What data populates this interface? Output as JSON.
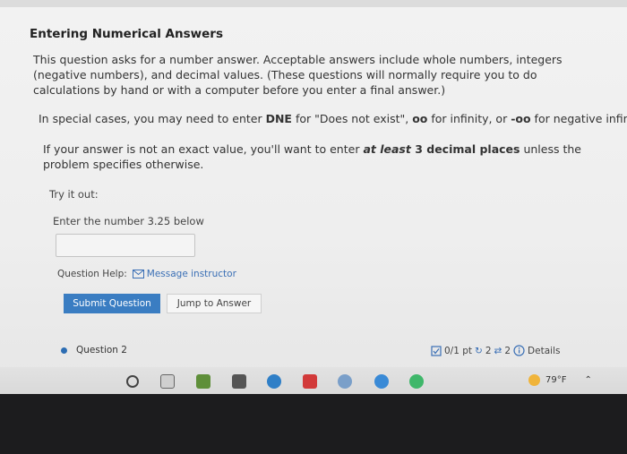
{
  "page": {
    "title": "Entering Numerical Answers",
    "intro": "This question asks for a number answer. Acceptable answers include whole numbers, integers (negative numbers), and decimal values. (These questions will normally require you to do calculations by hand or with a computer before you enter a final answer.)",
    "special_parts": {
      "a": "In special cases, you may need to enter ",
      "dne": "DNE",
      "b": " for \"Does not exist\", ",
      "oo": "oo",
      "c": " for infinity, or ",
      "neg_oo": "-oo",
      "d": " for negative infinity."
    },
    "decimal_parts": {
      "a": "If your answer is not an exact value, you'll want to enter ",
      "at": "at",
      "least": "least",
      "three": "3 decimal places",
      "b": " unless the problem specifies otherwise."
    },
    "try_it": "Try it out:",
    "enter_prompt": "Enter the number 3.25 below",
    "answer_value": "",
    "help_label": "Question Help:",
    "message_instructor": "Message instructor",
    "submit_label": "Submit Question",
    "jump_label": "Jump to Answer",
    "next_question": "Question 2",
    "score": "0/1 pt",
    "retries": "2",
    "attempts": "2",
    "details": "Details"
  },
  "taskbar": {
    "temperature": "79°F"
  },
  "colors": {
    "accent": "#3a7dc2",
    "link": "#3a6fb5"
  }
}
